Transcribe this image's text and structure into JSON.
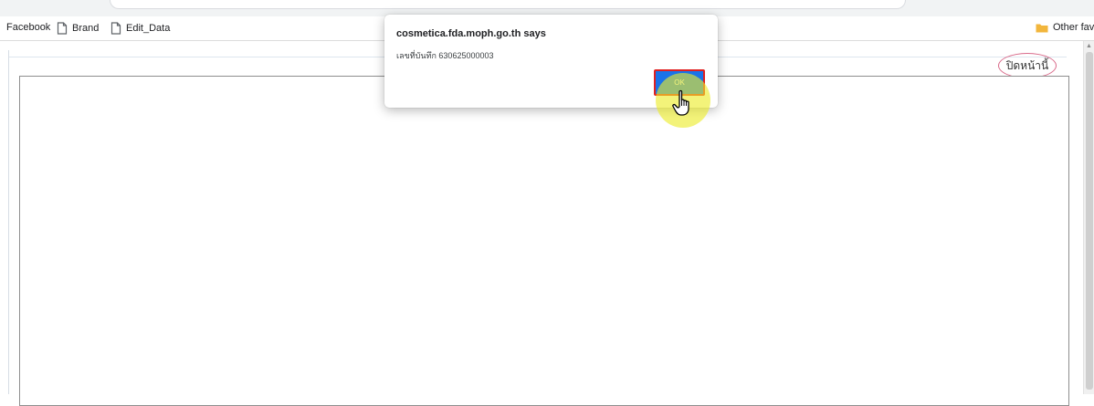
{
  "bookmarks_bar": {
    "items": [
      {
        "label": "Facebook",
        "icon": "none"
      },
      {
        "label": "Brand",
        "icon": "page-icon"
      },
      {
        "label": "Edit_Data",
        "icon": "page-icon"
      }
    ],
    "other": {
      "label": "Other favo",
      "icon": "folder-icon"
    }
  },
  "page": {
    "close_link": "ปิดหน้านี้"
  },
  "dialog": {
    "title": "cosmetica.fda.moph.go.th says",
    "message": "เลขที่บันทึก 630625000003",
    "ok_label": "OK"
  },
  "colors": {
    "ok_button": "#1a73e8",
    "ok_outline": "#e02020",
    "click_highlight": "#ecec28",
    "close_link_border": "#d96a8a",
    "folder": "#f2b63c"
  },
  "cursor": {
    "icon": "hand-pointer-icon"
  }
}
